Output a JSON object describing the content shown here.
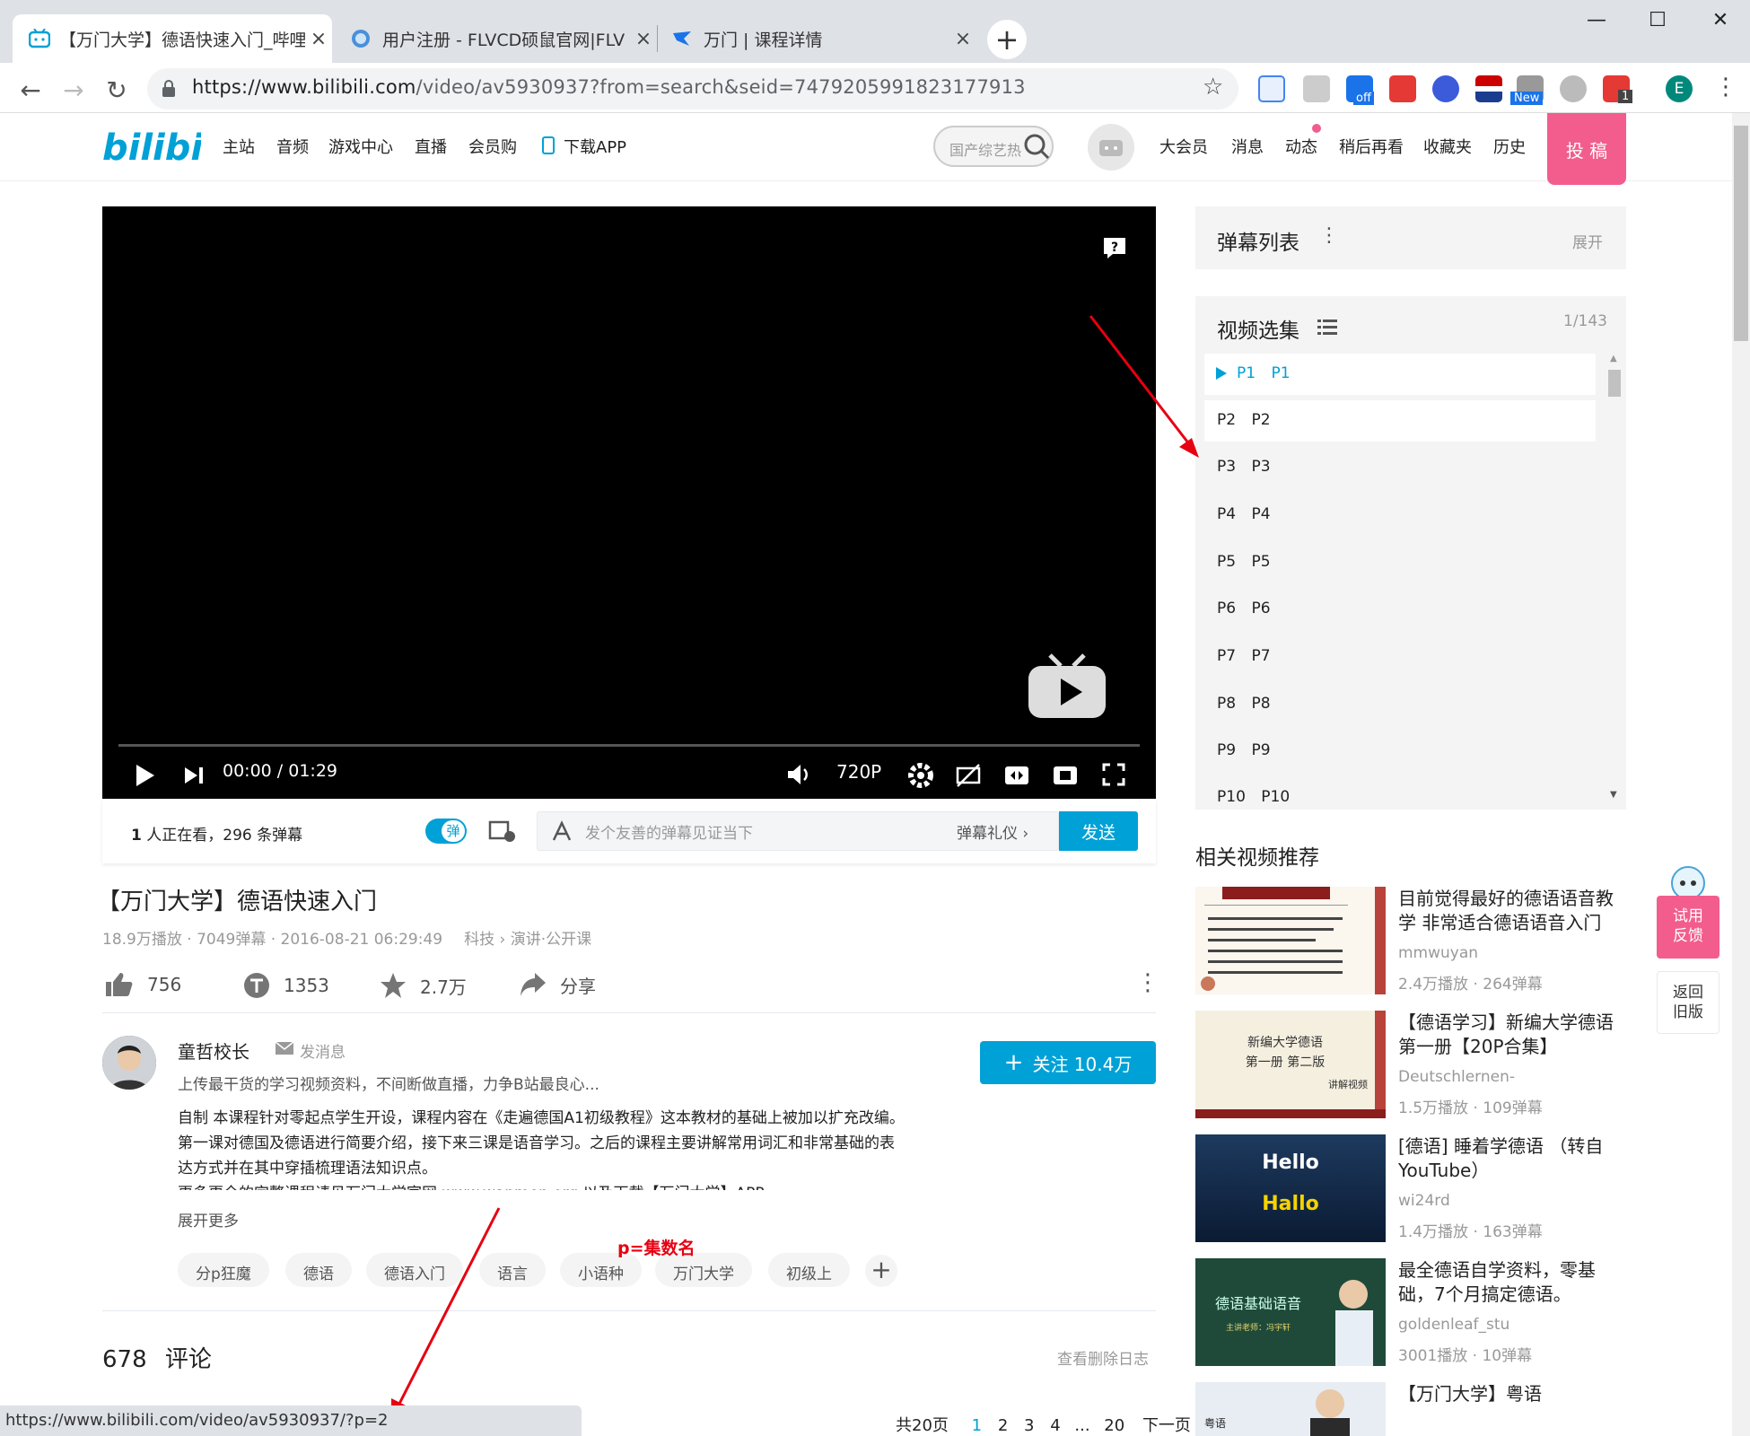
{
  "browser": {
    "tabs": [
      {
        "title": "【万门大学】德语快速入门_哔哩"
      },
      {
        "title": "用户注册 - FLVCD硕鼠官网|FLV"
      },
      {
        "title": "万门 | 课程详情"
      }
    ],
    "url_host": "https://www.bilibili.com",
    "url_path": "/video/av5930937?from=search&seid=7479205991823177913",
    "extension_badges": {
      "off": "off",
      "new": "New",
      "count": "1",
      "profile": "E"
    },
    "status_url": "https://www.bilibili.com/video/av5930937/?p=2"
  },
  "site": {
    "logo": "bilibili",
    "nav": [
      "主站",
      "音频",
      "游戏中心",
      "直播",
      "会员购",
      "下载APP"
    ],
    "search_placeholder": "国产综艺热",
    "right_nav": [
      "大会员",
      "消息",
      "动态",
      "稍后再看",
      "收藏夹",
      "历史"
    ],
    "upload": "投 稿"
  },
  "player": {
    "time_current": "00:00",
    "time_total": "01:29",
    "quality": "720P",
    "viewers_count": "1",
    "viewers_text": "人正在看，296 条弹幕",
    "danmaku_toggle": "弹",
    "danmaku_placeholder": "发个友善的弹幕见证当下",
    "danmaku_etiquette": "弹幕礼仪",
    "send": "发送"
  },
  "video": {
    "title": "【万门大学】德语快速入门",
    "meta": "18.9万播放 · 7049弹幕 · 2016-08-21 06:29:49",
    "category": "科技 › 演讲·公开课",
    "likes": "756",
    "coins": "1353",
    "favorites": "2.7万",
    "share": "分享"
  },
  "uploader": {
    "name": "童哲校长",
    "message": "发消息",
    "signature": "上传最干货的学习视频资料，不间断做直播，力争B站最良心...",
    "follow": "关注 10.4万"
  },
  "description": {
    "lines": [
      "自制 本课程针对零起点学生开设，课程内容在《走遍德国A1初级教程》这本教材的基础上被加以扩充改编。",
      "第一课对德国及德语进行简要介绍，接下来三课是语音学习。之后的课程主要讲解常用词汇和非常基础的表",
      "达方式并在其中穿插梳理语法知识点。",
      "更多更全的完整课程请见万门大学官网 www.wanmen.org 以及下载【万门大学】APP"
    ],
    "expand": "展开更多"
  },
  "tags": [
    "分p狂魔",
    "德语",
    "德语入门",
    "语言",
    "小语种",
    "万门大学",
    "初级上"
  ],
  "comments": {
    "count": "678",
    "label": "评论",
    "delete_log": "查看删除日志",
    "pager": {
      "total": "共20页",
      "pages": [
        "1",
        "2",
        "3",
        "4",
        "...",
        "20"
      ],
      "next": "下一页",
      "current": "1"
    }
  },
  "sidebar": {
    "danmaku_list": "弹幕列表",
    "expand": "展开",
    "playlist_title": "视频选集",
    "playlist_pos": "1/143",
    "episodes": [
      {
        "p": "P1",
        "name": "P1"
      },
      {
        "p": "P2",
        "name": "P2"
      },
      {
        "p": "P3",
        "name": "P3"
      },
      {
        "p": "P4",
        "name": "P4"
      },
      {
        "p": "P5",
        "name": "P5"
      },
      {
        "p": "P6",
        "name": "P6"
      },
      {
        "p": "P7",
        "name": "P7"
      },
      {
        "p": "P8",
        "name": "P8"
      },
      {
        "p": "P9",
        "name": "P9"
      },
      {
        "p": "P10",
        "name": "P10"
      }
    ]
  },
  "related": {
    "title": "相关视频推荐",
    "items": [
      {
        "title": "目前觉得最好的德语语音教学 非常适合德语语音入门",
        "up": "mmwuyan",
        "stats": "2.4万播放 · 264弹幕"
      },
      {
        "title": "【德语学习】新编大学德语第一册【20P合集】",
        "up": "Deutschlernen-",
        "stats": "1.5万播放 · 109弹幕",
        "thumb_text": [
          "新编大学德语",
          "第一册 第二版",
          "讲解视频"
        ]
      },
      {
        "title": "[德语] 睡着学德语 （转自YouTube）",
        "up": "wi24rd",
        "stats": "1.4万播放 · 163弹幕",
        "thumb_text": [
          "Hello",
          "Hallo"
        ]
      },
      {
        "title": "最全德语自学资料，零基础，7个月搞定德语。",
        "up": "goldenleaf_stu",
        "stats": "3001播放 · 10弹幕",
        "thumb_text": [
          "德语基础语音",
          "主讲老师：冯宇轩"
        ]
      },
      {
        "title": "【万门大学】粤语",
        "thumb_text": [
          "粤语"
        ]
      }
    ]
  },
  "floating": {
    "trial": "试用\n反馈",
    "trial_l1": "试用",
    "trial_l2": "反馈",
    "old_l1": "返回",
    "old_l2": "旧版"
  },
  "annotation": {
    "text": "p=集数名",
    "color": "#e60012"
  },
  "colors": {
    "brand_blue": "#00a1d6",
    "brand_pink": "#f25d8e"
  }
}
